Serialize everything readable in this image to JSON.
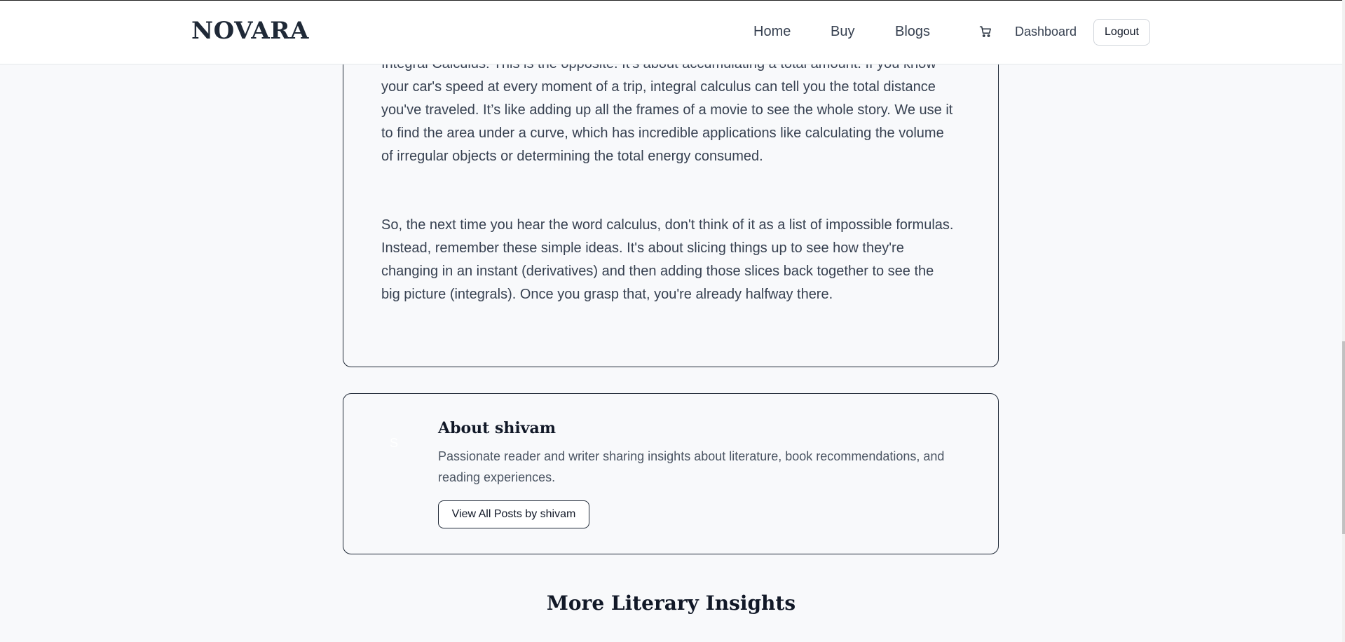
{
  "header": {
    "logo": "NOVARA",
    "nav": [
      "Home",
      "Buy",
      "Blogs"
    ],
    "cart_icon": "cart-icon",
    "dashboard": "Dashboard",
    "logout": "Logout"
  },
  "article": {
    "paragraphs": [
      "Integral Calculus: This is the opposite. It's about accumulating a total amount. If you know your car's speed at every moment of a trip, integral calculus can tell you the total distance you've traveled. It’s like adding up all the frames of a movie to see the whole story. We use it to find the area under a curve, which has incredible applications like calculating the volume of irregular objects or determining the total energy consumed.",
      "So, the next time you hear the word calculus, don't think of it as a list of impossible formulas. Instead, remember these simple ideas. It's about slicing things up to see how they're changing in an instant (derivatives) and then adding those slices back together to see the big picture (integrals). Once you grasp that, you're already halfway there."
    ]
  },
  "author": {
    "avatar_letter": "S",
    "title": "About shivam",
    "bio": "Passionate reader and writer sharing insights about literature, book recommendations, and reading experiences.",
    "button": "View All Posts by shivam"
  },
  "more": {
    "title": "More Literary Insights"
  },
  "colors": {
    "background": "#f8f9fb",
    "text": "#374151",
    "border": "#1f2937"
  }
}
